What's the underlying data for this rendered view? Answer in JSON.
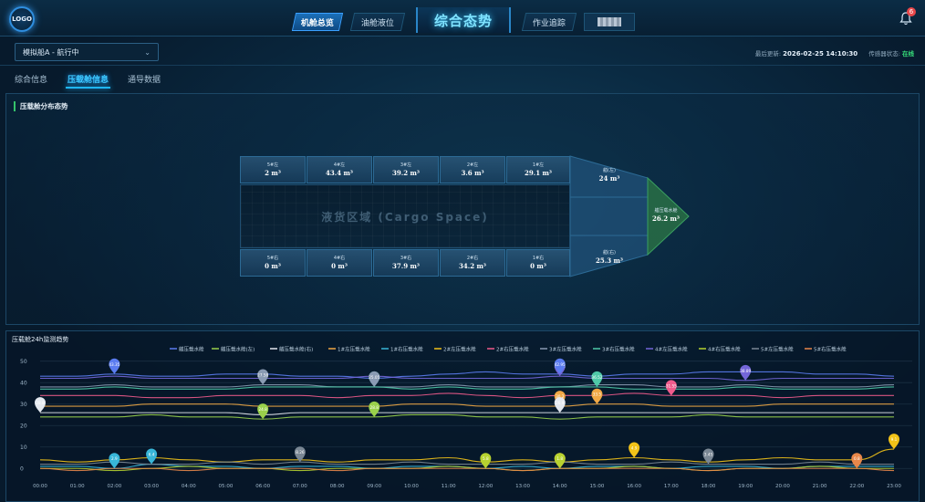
{
  "logo": "LOGO",
  "nav": {
    "items": [
      "机舱总览",
      "油舱液位",
      "作业追踪"
    ],
    "center_title": "综合态势",
    "notifications": "6"
  },
  "selector": {
    "value": "模拟船A - 航行中"
  },
  "status": {
    "updated_label": "最后更新:",
    "updated_value": "2026-02-25 14:10:30",
    "sensor_label": "传感器状态:",
    "sensor_value": "在线"
  },
  "tabs": [
    "综合信息",
    "压载舱信息",
    "通导数据"
  ],
  "ballast": {
    "title": "压载舱分布态势",
    "cargo_label": "液货区域 (Cargo Space)",
    "top": [
      {
        "name": "5#左",
        "value": "2 m³"
      },
      {
        "name": "4#左",
        "value": "43.4 m³"
      },
      {
        "name": "3#左",
        "value": "39.2 m³"
      },
      {
        "name": "2#左",
        "value": "3.6 m³"
      },
      {
        "name": "1#左",
        "value": "29.1 m³"
      }
    ],
    "bottom": [
      {
        "name": "5#右",
        "value": "0 m³"
      },
      {
        "name": "4#右",
        "value": "0 m³"
      },
      {
        "name": "3#右",
        "value": "37.9 m³"
      },
      {
        "name": "2#右",
        "value": "34.2 m³"
      },
      {
        "name": "1#右",
        "value": "0 m³"
      }
    ],
    "bow_top": {
      "name": "艏(左)",
      "value": "24 m³"
    },
    "bow_bottom": {
      "name": "艏(右)",
      "value": "25.3 m³"
    },
    "fore": {
      "name": "艏压载水舱",
      "value": "26.2 m³"
    }
  },
  "chart_title": "压载舱24h监测趋势",
  "chart_data": {
    "type": "line",
    "ylim": [
      -5,
      52
    ],
    "yticks": [
      0,
      10,
      20,
      30,
      40,
      50
    ],
    "x": [
      "00:00",
      "01:00",
      "02:00",
      "03:00",
      "04:00",
      "05:00",
      "06:00",
      "07:00",
      "08:00",
      "09:00",
      "10:00",
      "11:00",
      "12:00",
      "13:00",
      "14:00",
      "15:00",
      "16:00",
      "17:00",
      "18:00",
      "19:00",
      "20:00",
      "21:00",
      "22:00",
      "23:00"
    ],
    "series": [
      {
        "name": "艏压载水舱",
        "color": "#5b7cf0",
        "values": [
          43,
          43,
          44,
          43,
          43,
          44,
          44,
          43,
          43,
          42,
          43,
          44,
          45,
          44,
          44,
          43,
          44,
          44,
          45,
          45,
          45,
          44,
          44,
          43
        ]
      },
      {
        "name": "艏压载水舱(左)",
        "color": "#9ad14b",
        "values": [
          24,
          24,
          24,
          25,
          24,
          24,
          23,
          24,
          24,
          24,
          25,
          25,
          24,
          24,
          23,
          24,
          24,
          24,
          25,
          24,
          24,
          24,
          24,
          24
        ]
      },
      {
        "name": "艏压载水舱(右)",
        "color": "#e3e8ef",
        "values": [
          26,
          26,
          26,
          26,
          26,
          26,
          25,
          26,
          26,
          26,
          26,
          26,
          26,
          26,
          26,
          26,
          26,
          26,
          26,
          26,
          26,
          26,
          26,
          26
        ]
      },
      {
        "name": "1#左压载水舱",
        "color": "#f0a845",
        "values": [
          29,
          29,
          29,
          30,
          30,
          30,
          29,
          29,
          29,
          29,
          30,
          30,
          29,
          29,
          29,
          30,
          30,
          29,
          29,
          29,
          30,
          30,
          30,
          30
        ]
      },
      {
        "name": "1#右压载水舱",
        "color": "#38b6d8",
        "values": [
          1,
          1,
          0,
          2,
          1,
          1,
          0,
          1,
          1,
          0,
          1,
          1,
          0,
          1,
          0,
          1,
          1,
          0,
          1,
          1,
          0,
          1,
          1,
          1
        ]
      },
      {
        "name": "2#左压载水舱",
        "color": "#f2c318",
        "values": [
          4,
          3,
          4,
          5,
          4,
          3,
          4,
          4,
          3,
          4,
          4,
          5,
          3,
          4,
          3,
          4,
          5,
          4,
          3,
          4,
          5,
          4,
          4,
          9
        ]
      },
      {
        "name": "2#右压载水舱",
        "color": "#f05b8c",
        "values": [
          34,
          34,
          34,
          33,
          33,
          34,
          34,
          34,
          33,
          34,
          34,
          35,
          34,
          33,
          34,
          34,
          35,
          34,
          34,
          34,
          33,
          34,
          34,
          34
        ]
      },
      {
        "name": "3#左压载水舱",
        "color": "#8a9bb3",
        "values": [
          38,
          38,
          39,
          38,
          38,
          38,
          39,
          39,
          38,
          38,
          38,
          39,
          38,
          38,
          38,
          39,
          39,
          38,
          38,
          39,
          38,
          38,
          38,
          39
        ]
      },
      {
        "name": "3#右压载水舱",
        "color": "#4fc9a8",
        "values": [
          37,
          37,
          38,
          37,
          37,
          37,
          38,
          38,
          38,
          38,
          37,
          38,
          37,
          37,
          38,
          38,
          37,
          37,
          37,
          38,
          37,
          37,
          37,
          38
        ]
      },
      {
        "name": "4#左压载水舱",
        "color": "#7466d9",
        "values": [
          42,
          42,
          43,
          42,
          42,
          42,
          42,
          42,
          42,
          43,
          42,
          42,
          42,
          42,
          43,
          42,
          42,
          42,
          42,
          41,
          42,
          42,
          42,
          42
        ]
      },
      {
        "name": "4#右压载水舱",
        "color": "#b7d230",
        "values": [
          0,
          0,
          -1,
          0,
          1,
          0,
          0,
          -1,
          0,
          0,
          0,
          1,
          0,
          -1,
          0,
          0,
          1,
          0,
          -1,
          0,
          0,
          1,
          0,
          0
        ]
      },
      {
        "name": "5#左压载水舱",
        "color": "#7a8794",
        "values": [
          2,
          2,
          3,
          2,
          2,
          3,
          2,
          3,
          2,
          2,
          3,
          2,
          2,
          2,
          3,
          2,
          2,
          3,
          2,
          2,
          2,
          3,
          2,
          2
        ]
      },
      {
        "name": "5#右压载水舱",
        "color": "#e8874a",
        "values": [
          0,
          -1,
          0,
          0,
          -1,
          0,
          0,
          0,
          -1,
          0,
          0,
          0,
          0,
          -1,
          0,
          0,
          0,
          0,
          -1,
          0,
          0,
          0,
          0,
          -1
        ]
      }
    ],
    "markers": [
      {
        "series": 2,
        "x": 0,
        "label": "28.8"
      },
      {
        "series": 0,
        "x": 2,
        "label": "43.35"
      },
      {
        "series": 8,
        "x": 9,
        "label": "40.93"
      },
      {
        "series": 9,
        "x": 14,
        "label": "45.83"
      },
      {
        "series": 0,
        "x": 14,
        "label": "42.95"
      },
      {
        "series": 8,
        "x": 15,
        "label": "36.52"
      },
      {
        "series": 6,
        "x": 17,
        "label": "31.55"
      },
      {
        "series": 9,
        "x": 19,
        "label": "38.89"
      },
      {
        "series": 3,
        "x": 15,
        "label": "33.5"
      },
      {
        "series": 3,
        "x": 14,
        "label": "30.2"
      },
      {
        "series": 2,
        "x": 14,
        "label": "26.9"
      },
      {
        "series": 1,
        "x": 6,
        "label": "24.8"
      },
      {
        "series": 7,
        "x": 6,
        "label": "27.58"
      },
      {
        "series": 7,
        "x": 9,
        "label": "25.05"
      },
      {
        "series": 1,
        "x": 9,
        "label": "28.8"
      },
      {
        "series": 4,
        "x": 2,
        "label": "2.9"
      },
      {
        "series": 4,
        "x": 3,
        "label": "6.4"
      },
      {
        "series": 11,
        "x": 7,
        "label": "8.26"
      },
      {
        "series": 10,
        "x": 12,
        "label": "5.8"
      },
      {
        "series": 12,
        "x": 14,
        "label": "6.1"
      },
      {
        "series": 10,
        "x": 14,
        "label": "1.8"
      },
      {
        "series": 5,
        "x": 16,
        "label": "4.9"
      },
      {
        "series": 11,
        "x": 18,
        "label": "3.45"
      },
      {
        "series": 12,
        "x": 22,
        "label": "0.8"
      },
      {
        "series": 5,
        "x": 23,
        "label": "9.1"
      }
    ]
  }
}
